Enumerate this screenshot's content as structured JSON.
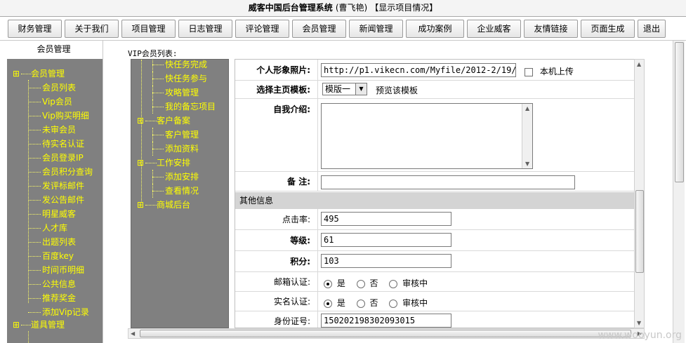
{
  "app": {
    "title": "威客中国后台管理系统",
    "user": "(曹飞艳)",
    "current_view": "【显示项目情况】"
  },
  "top_menu": [
    "财务管理",
    "关于我们",
    "项目管理",
    "日志管理",
    "评论管理",
    "会员管理",
    "新闻管理",
    "成功案例",
    "企业威客",
    "友情链接",
    "页面生成",
    "退出"
  ],
  "sidebar": {
    "title": "会员管理",
    "group_label": "会员管理",
    "items": [
      "会员列表",
      "Vip会员",
      "Vip购买明细",
      "未审会员",
      "待实名认证",
      "会员登录IP",
      "会员积分查询",
      "发评标邮件",
      "发公告邮件",
      "明星威客",
      "人才库",
      "出题列表",
      "百度key",
      "时间币明细",
      "公共信息",
      "推荐奖金",
      "添加Vip记录"
    ],
    "next_group_label": "道具管理"
  },
  "content": {
    "list_label": "VIP会员列表:"
  },
  "middle_tree": {
    "items": [
      {
        "label": "快任务完成",
        "level": 1
      },
      {
        "label": "快任务参与",
        "level": 1
      },
      {
        "label": "攻略管理",
        "level": 1
      },
      {
        "label": "我的备忘项目",
        "level": 1
      },
      {
        "label": "客户备案",
        "level": 0
      },
      {
        "label": "客户管理",
        "level": 1
      },
      {
        "label": "添加资料",
        "level": 1
      },
      {
        "label": "工作安排",
        "level": 0
      },
      {
        "label": "添加安排",
        "level": 1
      },
      {
        "label": "查看情况",
        "level": 1
      },
      {
        "label": "商城后台",
        "level": 0
      }
    ]
  },
  "form": {
    "photo_label": "个人形象照片:",
    "photo_value": "http://p1.vikecn.com/Myfile/2012-2/19/2",
    "local_upload_label": "本机上传",
    "template_label": "选择主页模板:",
    "template_value": "模版一",
    "preview_label": "预览该模板",
    "intro_label": "自我介绍:",
    "intro_value": "",
    "note_label": "备 注:",
    "note_value": "",
    "other_section": "其他信息",
    "clicks_label": "点击率:",
    "clicks_value": "495",
    "level_label": "等级:",
    "level_value": "61",
    "points_label": "积分:",
    "points_value": "103",
    "email_verify_label": "邮箱认证:",
    "realname_verify_label": "实名认证:",
    "radio_yes": "是",
    "radio_no": "否",
    "radio_review": "审核中",
    "email_verify_selected": "是",
    "realname_verify_selected": "是",
    "idcard_label": "身份证号:",
    "idcard_value": "150202198302093015"
  },
  "watermark": "www.wooyun.org",
  "colors": {
    "tree_bg": "#808080",
    "tree_text": "#ffff00",
    "section_bg": "#d4d4d4"
  }
}
